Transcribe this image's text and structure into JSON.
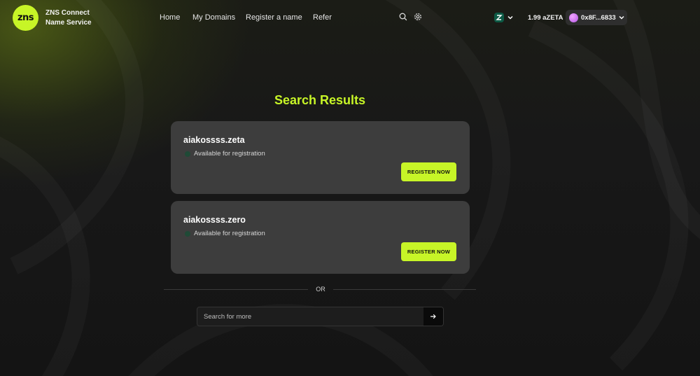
{
  "brand": {
    "logo_text": "zns",
    "name_line1": "ZNS Connect",
    "name_line2": "Name Service",
    "accent_color": "#c7f527"
  },
  "nav": {
    "home": "Home",
    "my_domains": "My Domains",
    "register": "Register a name",
    "refer": "Refer"
  },
  "header_icons": {
    "search": "search-icon",
    "settings": "gear-icon",
    "chain": "zetachain-icon"
  },
  "wallet": {
    "balance": "1.99 aZETA",
    "address": "0x8F...6833"
  },
  "main": {
    "title": "Search Results",
    "results": [
      {
        "domain": "aiakossss.zeta",
        "status": "Available for registration",
        "button": "REGISTER NOW"
      },
      {
        "domain": "aiakossss.zero",
        "status": "Available for registration",
        "button": "REGISTER NOW"
      }
    ],
    "divider": "OR",
    "search": {
      "placeholder": "Search for more",
      "value": ""
    }
  }
}
